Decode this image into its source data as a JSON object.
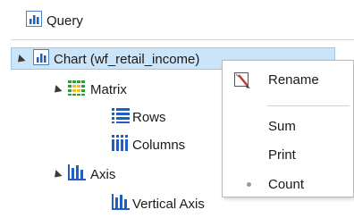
{
  "tree": {
    "root_label": "Query",
    "chart_label": "Chart (wf_retail_income)",
    "matrix_label": "Matrix",
    "rows_label": "Rows",
    "columns_label": "Columns",
    "axis_label": "Axis",
    "vertical_axis_label": "Vertical Axis"
  },
  "context_menu": {
    "items": [
      {
        "label": "Rename",
        "icon": "rename-icon"
      },
      {
        "label": "Sum"
      },
      {
        "label": "Print"
      },
      {
        "label": "Count",
        "checked": true
      }
    ]
  },
  "colors": {
    "selection_bg": "#cce4f7",
    "selection_border": "#99c9ef",
    "icon_blue": "#1f5fbf",
    "matrix_green": "#2e9e3a"
  }
}
